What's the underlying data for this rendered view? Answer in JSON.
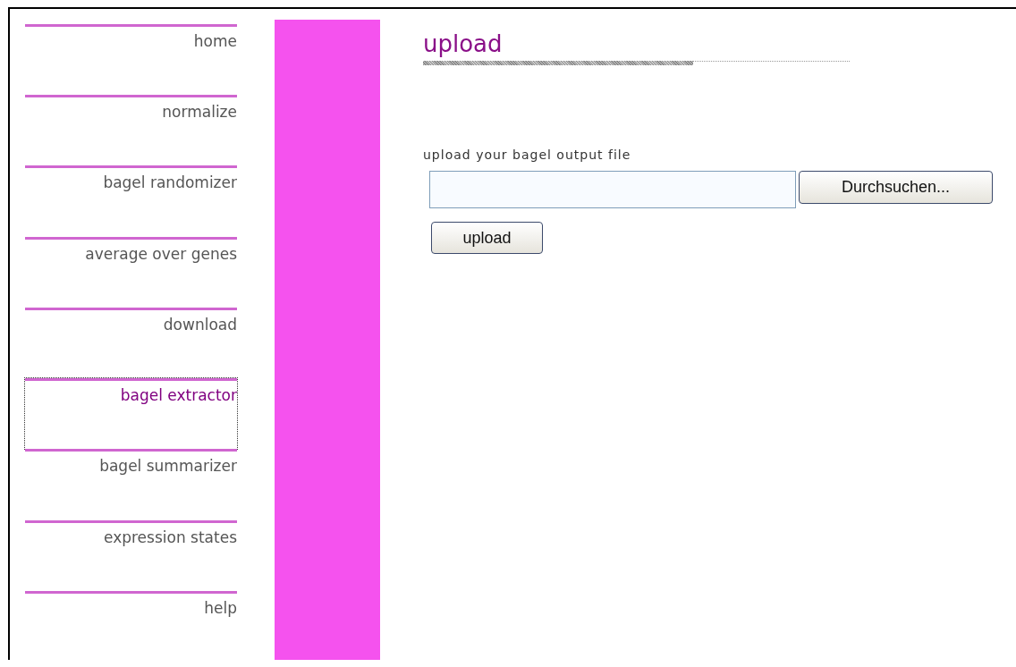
{
  "sidebar": {
    "items": [
      {
        "label": "home",
        "selected": false
      },
      {
        "label": "normalize",
        "selected": false
      },
      {
        "label": "bagel randomizer",
        "selected": false
      },
      {
        "label": "average over genes",
        "selected": false
      },
      {
        "label": "download",
        "selected": false
      },
      {
        "label": "bagel extractor",
        "selected": true
      },
      {
        "label": "bagel summarizer",
        "selected": false
      },
      {
        "label": "expression states",
        "selected": false
      },
      {
        "label": "help",
        "selected": false
      }
    ]
  },
  "main": {
    "title": "upload",
    "field_label": "upload your bagel output file",
    "file_field": {
      "button": "Durchsuchen..."
    },
    "submit": "upload"
  }
}
